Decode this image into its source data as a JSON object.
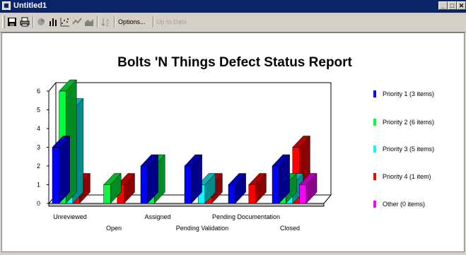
{
  "window": {
    "title": "Untitled1",
    "minimize": "_",
    "maximize": "□",
    "close": "✕"
  },
  "toolbar": {
    "options_label": "Options...",
    "uptodate_label": "Up to Date"
  },
  "chart_data": {
    "type": "bar",
    "title": "Bolts 'N Things Defect Status Report",
    "categories": [
      "Unreviewed",
      "Open",
      "Assigned",
      "Pending Validation",
      "Pending Documentation",
      "Closed"
    ],
    "ylim": [
      0,
      6
    ],
    "yticks": [
      0,
      1,
      2,
      3,
      4,
      5,
      6
    ],
    "grid": false,
    "legend_position": "right",
    "series": [
      {
        "name": "Priority 1 (3 items)",
        "color": "#0000ff",
        "side": "#00008c",
        "top": "#0000b4",
        "values": [
          3,
          0,
          2,
          2,
          1,
          2
        ]
      },
      {
        "name": "Priority 2 (6 items)",
        "color": "#00ff40",
        "side": "#008c23",
        "top": "#00b42d",
        "values": [
          6,
          1,
          2,
          0,
          0,
          1
        ]
      },
      {
        "name": "Priority 3 (5 items)",
        "color": "#00ffff",
        "side": "#008c8c",
        "top": "#00b4b4",
        "values": [
          5,
          0,
          0,
          1,
          0,
          1
        ]
      },
      {
        "name": "Priority 4 (1 item)",
        "color": "#ff0000",
        "side": "#8c0000",
        "top": "#b40000",
        "values": [
          1,
          1,
          0,
          1,
          1,
          3
        ]
      },
      {
        "name": "Other (0 items)",
        "color": "#ff00ff",
        "side": "#8c008c",
        "top": "#b400b4",
        "values": [
          0,
          0,
          0,
          0,
          0,
          1
        ]
      }
    ]
  }
}
